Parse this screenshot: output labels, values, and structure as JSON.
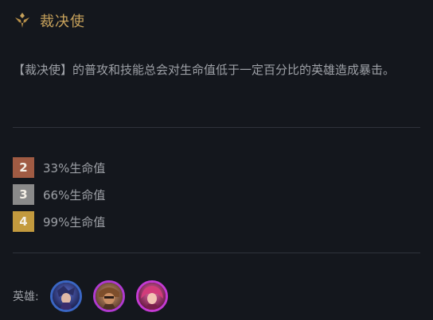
{
  "trait": {
    "icon": "sword-icon",
    "title": "裁决使",
    "description": "【裁决使】的普攻和技能总会对生命值低于一定百分比的英雄造成暴击。"
  },
  "tiers": [
    {
      "count": "2",
      "text": "33%生命值",
      "color": "#a05b43"
    },
    {
      "count": "3",
      "text": "66%生命值",
      "color": "#8a8a8a"
    },
    {
      "count": "4",
      "text": "99%生命值",
      "color": "#c39a3e"
    }
  ],
  "champions": {
    "label": "英雄:",
    "items": [
      {
        "name": "champion-portrait-1",
        "border": "#3a66c4"
      },
      {
        "name": "champion-portrait-2",
        "border": "#b03ad0"
      },
      {
        "name": "champion-portrait-3",
        "border": "#c43ad2"
      }
    ]
  }
}
